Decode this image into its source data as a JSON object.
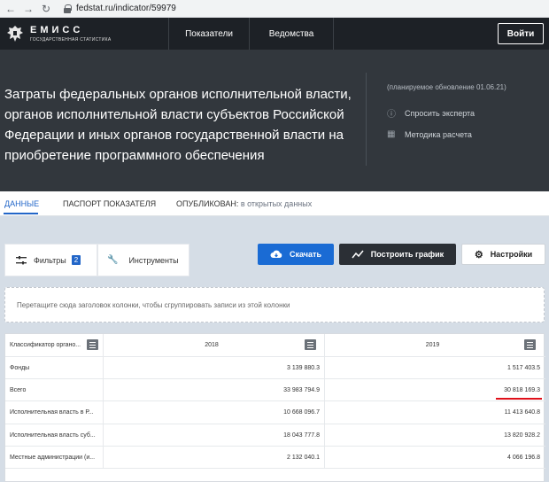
{
  "browser": {
    "url": "fedstat.ru/indicator/59979"
  },
  "nav": {
    "logo_title": "ЕМИСС",
    "logo_sub": "ГОСУДАРСТВЕННАЯ СТАТИСТИКА",
    "item1": "Показатели",
    "item2": "Ведомства",
    "login": "Войти"
  },
  "hero": {
    "title": "Затраты федеральных органов исполнительной власти, органов исполнительной власти субъектов Российской Федерации и иных органов государственной власти на приобретение программного обеспечения",
    "update": "(планируемое обновление 01.06.21)",
    "ask_expert": "Спросить эксперта",
    "methodology": "Методика расчета"
  },
  "tabs": {
    "data": "ДАННЫЕ",
    "passport": "ПАСПОРТ ПОКАЗАТЕЛЯ",
    "published_label": "ОПУБЛИКОВАН:",
    "published_value": "в открытых данных"
  },
  "toolbar": {
    "filters": "Фильтры",
    "filters_count": "2",
    "tools": "Инструменты",
    "download": "Скачать",
    "build_chart": "Построить график",
    "settings": "Настройки"
  },
  "grouping_hint": "Перетащите сюда заголовок колонки, чтобы сгруппировать записи из этой колонки",
  "table": {
    "headers": [
      "Классификатор органо...",
      "2018",
      "2019"
    ],
    "rows": [
      [
        "Фонды",
        "3 139 880.3",
        "1 517 403.5"
      ],
      [
        "Всего",
        "33 983 794.9",
        "30 818 169.3"
      ],
      [
        "Исполнительная власть в Р...",
        "10 668 096.7",
        "11 413 640.8"
      ],
      [
        "Исполнительная власть суб...",
        "18 043 777.8",
        "13 820 928.2"
      ],
      [
        "Местные администрации (и...",
        "2 132 040.1",
        "4 066 196.8"
      ]
    ]
  },
  "colors": {
    "accent": "#1a6bd4",
    "nav_bg": "#1d2126",
    "hero_bg": "#32373d",
    "highlight": "#e0101a"
  }
}
